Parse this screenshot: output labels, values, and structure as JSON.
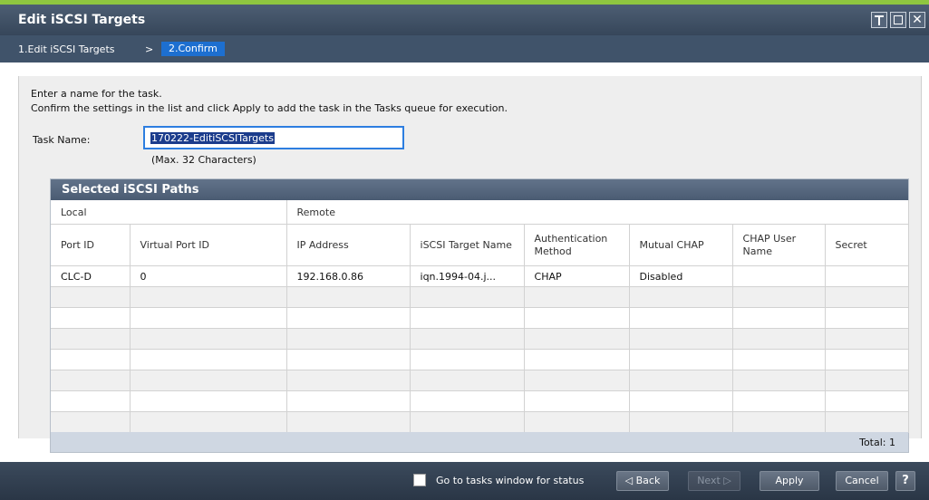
{
  "window": {
    "title": "Edit iSCSI Targets"
  },
  "breadcrumb": {
    "step1": "1.Edit iSCSI Targets",
    "separator": ">",
    "step2": "2.Confirm"
  },
  "instructions": {
    "line1": "Enter a name for the task.",
    "line2": "Confirm the settings in the list and click Apply to add the task in the Tasks queue for execution."
  },
  "task": {
    "label": "Task Name:",
    "value": "170222-EditiSCSITargets",
    "hint": "(Max. 32 Characters)"
  },
  "panel": {
    "title": "Selected iSCSI Paths",
    "groups": [
      "Local",
      "Remote"
    ],
    "columns": [
      "Port ID",
      "Virtual Port ID",
      "IP Address",
      "iSCSI Target Name",
      "Authentication Method",
      "Mutual CHAP",
      "CHAP User Name",
      "Secret"
    ],
    "rows": [
      [
        "CLC-D",
        "0",
        "192.168.0.86",
        "iqn.1994-04.j...",
        "CHAP",
        "Disabled",
        "",
        ""
      ]
    ],
    "total": "Total:  1"
  },
  "footer": {
    "checkbox_label": "Go to tasks window for status",
    "back": "Back",
    "next": "Next",
    "apply": "Apply",
    "cancel": "Cancel",
    "help": "?"
  },
  "colors": {
    "accent_green": "#8ec640",
    "selected_step": "#1d6fd0",
    "title_bar": "#4d5e73"
  }
}
